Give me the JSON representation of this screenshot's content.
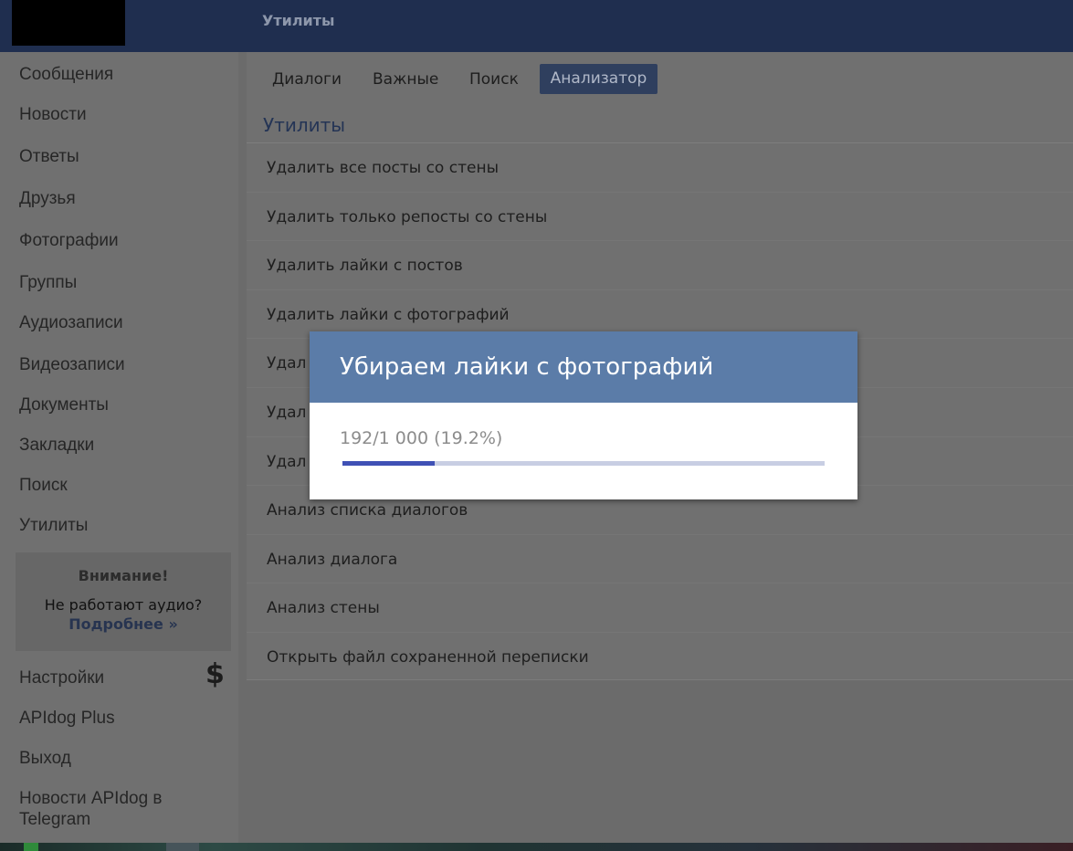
{
  "header": {
    "title": "Утилиты"
  },
  "sidebar": {
    "items": [
      {
        "label": "Сообщения"
      },
      {
        "label": "Новости"
      },
      {
        "label": "Ответы"
      },
      {
        "label": "Друзья"
      },
      {
        "label": "Фотографии"
      },
      {
        "label": "Группы"
      },
      {
        "label": "Аудиозаписи"
      },
      {
        "label": "Видеозаписи"
      },
      {
        "label": "Документы"
      },
      {
        "label": "Закладки"
      },
      {
        "label": "Поиск"
      },
      {
        "label": "Утилиты"
      }
    ],
    "notice": {
      "title": "Внимание!",
      "text": "Не работают аудио?",
      "link": "Подробнее »"
    },
    "bottom_items": [
      {
        "label": "Настройки"
      },
      {
        "label": "APIdog Plus"
      },
      {
        "label": "Выход"
      },
      {
        "label_line1": "Новости APIdog в",
        "label_line2": "Telegram"
      }
    ],
    "dollar_icon": "dollar-icon"
  },
  "main": {
    "tabs": [
      {
        "label": "Диалоги"
      },
      {
        "label": "Важные"
      },
      {
        "label": "Поиск"
      },
      {
        "label": "Анализатор",
        "active": true
      }
    ],
    "section_title": "Утилиты",
    "items": [
      {
        "label": "Удалить все посты со стены"
      },
      {
        "label": "Удалить только репосты со стены"
      },
      {
        "label": "Удалить лайки с постов"
      },
      {
        "label": "Удалить лайки с фотографий"
      },
      {
        "label": "Удал"
      },
      {
        "label": "Удал"
      },
      {
        "label": "Удал"
      },
      {
        "label": "Анализ списка диалогов"
      },
      {
        "label": "Анализ диалога"
      },
      {
        "label": "Анализ стены"
      },
      {
        "label": "Открыть файл сохраненной переписки"
      }
    ]
  },
  "modal": {
    "title": "Убираем лайки с фотографий",
    "progress_text": "192/1 000 (19.2%)",
    "progress_fraction": 0.192,
    "colors": {
      "header": "#5b7ca8",
      "fill": "#3f51b5",
      "track": "#c8cee3"
    }
  }
}
